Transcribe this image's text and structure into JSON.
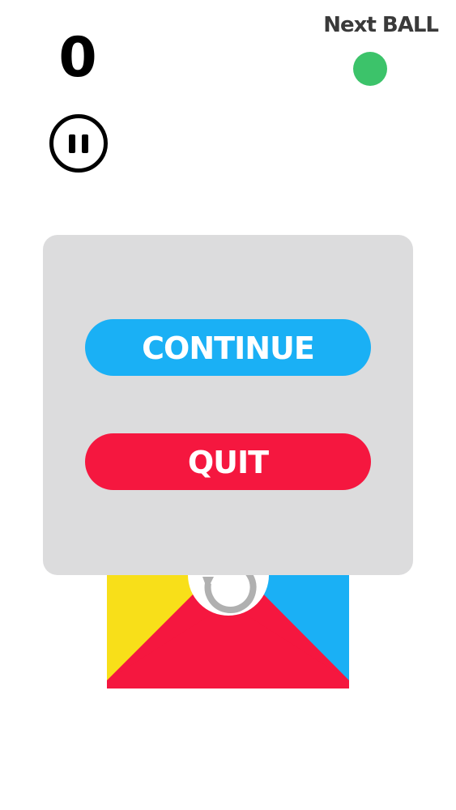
{
  "hud": {
    "score": "0",
    "next_ball_label": "Next BALL",
    "next_ball_color": "#3cc36a",
    "pause_icon": "pause-icon"
  },
  "pause_menu": {
    "continue_label": "CONTINUE",
    "quit_label": "QUIT",
    "continue_color": "#1ab0f5",
    "quit_color": "#f5173f",
    "panel_color": "#dcdcdd"
  },
  "board": {
    "colors": {
      "yellow": "#f8df19",
      "blue": "#1ab0f5",
      "red": "#f5173f",
      "hub": "#ffffff"
    },
    "hub_icon": "rotate-icon"
  }
}
